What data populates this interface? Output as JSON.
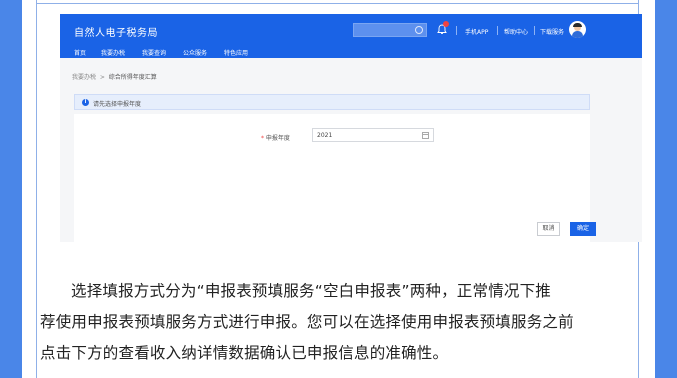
{
  "site": {
    "brand": "自然人电子税务局",
    "top_links": [
      "手机APP",
      "帮助中心",
      "下载服务"
    ],
    "nav": [
      "首页",
      "我要办税",
      "我要查询",
      "公众服务",
      "特色应用"
    ]
  },
  "breadcrumb": {
    "parent": "我要办税",
    "separator": ">",
    "current": "综合所得年度汇算"
  },
  "notice": {
    "icon": "i",
    "text": "请先选择申报年度"
  },
  "form": {
    "required_mark": "*",
    "year_label": "申报年度",
    "year_value": "2021"
  },
  "actions": {
    "cancel": "取消",
    "confirm": "确定"
  },
  "article": {
    "line1": "选择填报方式分为“申报表预填服务“空白申报表”两种，正常情况下推",
    "line2": "荐使用申报表预填服务方式进行申报。您可以在选择使用申报表预填服务之前",
    "line3": "点击下方的查看收入纳详情数据确认已申报信息的准确性。"
  },
  "colors": {
    "page_border": "#4a86e8",
    "header_blue": "#1a63e6",
    "notice_bg": "#e6eefc",
    "required": "#f04343"
  }
}
